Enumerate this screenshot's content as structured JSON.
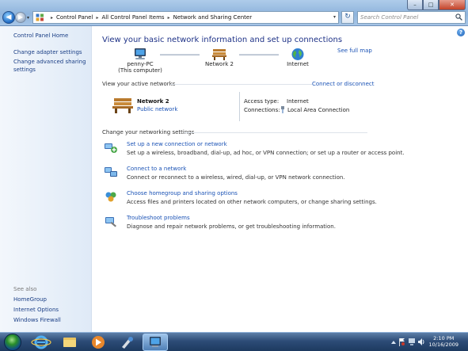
{
  "window": {
    "controls": {
      "minimize": "–",
      "maximize": "□",
      "close": "✕"
    }
  },
  "address_bar": {
    "crumbs": [
      "Control Panel",
      "All Control Panel Items",
      "Network and Sharing Center"
    ],
    "separator": "▸"
  },
  "search": {
    "placeholder": "Search Control Panel"
  },
  "left_pane": {
    "home": "Control Panel Home",
    "links": [
      "Change adapter settings",
      "Change advanced sharing settings"
    ],
    "see_also_label": "See also",
    "see_also": [
      "HomeGroup",
      "Internet Options",
      "Windows Firewall"
    ]
  },
  "main": {
    "title": "View your basic network information and set up connections",
    "see_full_map": "See full map",
    "map": {
      "computer": {
        "name": "penny-PC",
        "sub": "(This computer)",
        "icon": "computer-icon"
      },
      "network": {
        "name": "Network  2",
        "icon": "bench-network-icon"
      },
      "internet": {
        "name": "Internet",
        "icon": "globe-icon"
      }
    },
    "active_networks_label": "View your active networks",
    "connect_or_disconnect": "Connect or disconnect",
    "active_network": {
      "name": "Network  2",
      "type": "Public network",
      "access_type_label": "Access type:",
      "access_type_value": "Internet",
      "connections_label": "Connections:",
      "connections_value": "Local Area Connection"
    },
    "change_settings_label": "Change your networking settings",
    "tasks": [
      {
        "link": "Set up a new connection or network",
        "desc": "Set up a wireless, broadband, dial-up, ad hoc, or VPN connection; or set up a router or access point.",
        "icon": "new-connection-icon"
      },
      {
        "link": "Connect to a network",
        "desc": "Connect or reconnect to a wireless, wired, dial-up, or VPN network connection.",
        "icon": "connect-network-icon"
      },
      {
        "link": "Choose homegroup and sharing options",
        "desc": "Access files and printers located on other network computers, or change sharing settings.",
        "icon": "homegroup-icon"
      },
      {
        "link": "Troubleshoot problems",
        "desc": "Diagnose and repair network problems, or get troubleshooting information.",
        "icon": "troubleshoot-icon"
      }
    ],
    "help": "?"
  },
  "taskbar": {
    "time": "2:10 PM",
    "date": "10/16/2009"
  },
  "colors": {
    "link": "#1a52b5",
    "title": "#1e3287",
    "taskbar": "#2d4c77"
  }
}
